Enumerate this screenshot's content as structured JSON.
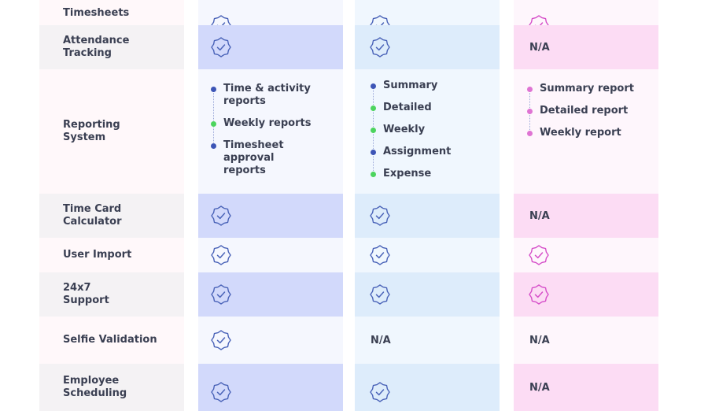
{
  "colors": {
    "feature_bg_dark": "#f4f2f4",
    "feature_bg_light": "#fff8fa",
    "colA_dark": "#d2d9fb",
    "colA_light": "#f5f7fe",
    "colB_dark": "#ddecfb",
    "colB_light": "#f0f7fe",
    "colC_dark": "#fcdcf4",
    "colC_light": "#fef6fc",
    "check_blue": "#4a63b8",
    "check_pink": "#d64fc9",
    "dot_blue": "#3d55b6",
    "dot_green": "#4cd45e",
    "dot_pink": "#df74d3"
  },
  "rows": [
    {
      "feature": "Timesheets",
      "a": "check",
      "b": "check",
      "c": "check"
    },
    {
      "feature": "Attendance\nTracking",
      "a": "check",
      "b": "check",
      "c": "N/A"
    },
    {
      "feature": "Reporting\nSystem",
      "a": "list",
      "b": "list",
      "c": "list"
    },
    {
      "feature": "Time Card\nCalculator",
      "a": "check",
      "b": "check",
      "c": "N/A"
    },
    {
      "feature": "User Import",
      "a": "check",
      "b": "check",
      "c": "check"
    },
    {
      "feature": "24x7\nSupport",
      "a": "check",
      "b": "check",
      "c": "check"
    },
    {
      "feature": "Selfie Validation",
      "a": "check",
      "b": "N/A",
      "c": "N/A"
    },
    {
      "feature": "Employee\nScheduling",
      "a": "check",
      "b": "check",
      "c": "N/A"
    }
  ],
  "reporting": {
    "a": [
      {
        "label": "Time & activity reports",
        "dot": "blue"
      },
      {
        "label": "Weekly reports",
        "dot": "green"
      },
      {
        "label": "Timesheet approval reports",
        "dot": "blue"
      }
    ],
    "b": [
      {
        "label": "Summary",
        "dot": "blue"
      },
      {
        "label": "Detailed",
        "dot": "green"
      },
      {
        "label": "Weekly",
        "dot": "green"
      },
      {
        "label": "Assignment",
        "dot": "blue"
      },
      {
        "label": "Expense",
        "dot": "green"
      }
    ],
    "c": [
      {
        "label": "Summary report",
        "dot": "pink"
      },
      {
        "label": "Detailed report",
        "dot": "pink"
      },
      {
        "label": "Weekly report",
        "dot": "pink"
      }
    ]
  }
}
